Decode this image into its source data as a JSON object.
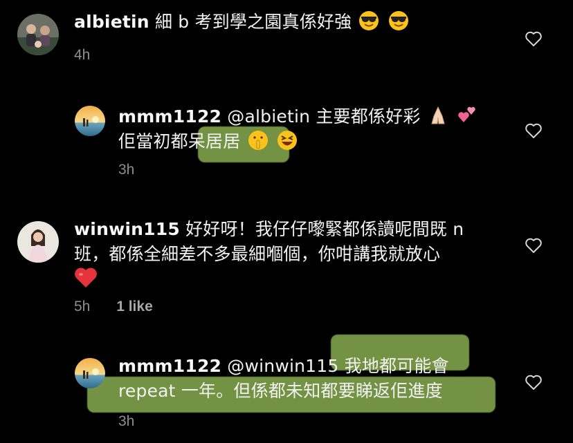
{
  "comments": [
    {
      "username": "albietin",
      "text": "細 b 考到學之園真係好強",
      "emojis": [
        "sunglasses-face",
        "sunglasses-face"
      ],
      "time": "4h"
    },
    {
      "username": "mmm1122",
      "mention": "@albietin",
      "text_line1": "主要都係好彩",
      "emojis_line1": [
        "folded-hands",
        "two-hearts"
      ],
      "text_line2_a": "佢當初都",
      "text_line2_b": "呆居居",
      "emojis_line2": [
        "shushing-face",
        "grinning-squinting-face"
      ],
      "time": "3h"
    },
    {
      "username": "winwin115",
      "text_line1": "好好呀！我仔仔嚟緊都係讀呢間既 n",
      "text_line2": "班，都係全細差不多最細嗰個，你咁講我就放心",
      "emoji_line3": "red-heart",
      "time": "5h",
      "likes": "1 like"
    },
    {
      "username": "mmm1122",
      "mention": "@winwin115",
      "text_line1": "我地都可能會",
      "text_line2": "repeat 一年。但係都未知都要睇返佢進度",
      "time": "3h"
    }
  ],
  "colors": {
    "background": "#000000",
    "text": "#f2f2f2",
    "meta": "#8e8e8e",
    "highlight": "#93bb56",
    "heart_red": "#e0245e"
  }
}
